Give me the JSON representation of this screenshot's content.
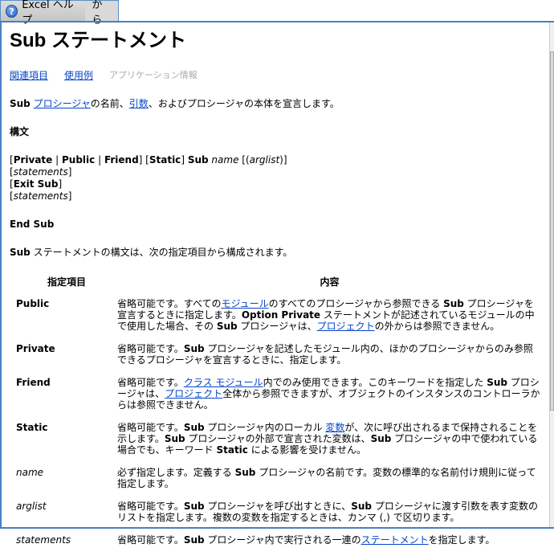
{
  "tabs": {
    "app": "Excel ヘルプ",
    "from": "から"
  },
  "title": "Sub ステートメント",
  "nav": {
    "related": "関連項目",
    "example": "使用例",
    "app_info": "アプリケーション情報"
  },
  "intro": [
    {
      "b": "Sub"
    },
    {
      "t": " "
    },
    {
      "a": "プロシージャ"
    },
    {
      "t": "の名前、"
    },
    {
      "a": "引数"
    },
    {
      "t": "、およびプロシージャの本体を宣言します。"
    }
  ],
  "syntax_heading": "構文",
  "syntax": {
    "line1": [
      {
        "t": "["
      },
      {
        "b": "Private"
      },
      {
        "t": " | "
      },
      {
        "b": "Public"
      },
      {
        "t": " | "
      },
      {
        "b": "Friend"
      },
      {
        "t": "] ["
      },
      {
        "b": "Static"
      },
      {
        "t": "] "
      },
      {
        "b": "Sub"
      },
      {
        "t": " "
      },
      {
        "i": "name"
      },
      {
        "t": " [("
      },
      {
        "i": "arglist"
      },
      {
        "t": ")]"
      }
    ],
    "line2": [
      {
        "t": "["
      },
      {
        "i": "statements"
      },
      {
        "t": "]"
      }
    ],
    "line3": [
      {
        "t": "["
      },
      {
        "b": "Exit Sub"
      },
      {
        "t": "]"
      }
    ],
    "line4": [
      {
        "t": "["
      },
      {
        "i": "statements"
      },
      {
        "t": "]"
      }
    ],
    "end": "End Sub"
  },
  "summary": [
    {
      "b": "Sub"
    },
    {
      "t": " ステートメントの構文は、次の指定項目から構成されます。"
    }
  ],
  "table": {
    "headers": [
      "指定項目",
      "内容"
    ],
    "rows": [
      {
        "key": "Public",
        "italic": false,
        "desc": [
          {
            "t": "省略可能です。すべての"
          },
          {
            "a": "モジュール"
          },
          {
            "t": "のすべてのプロシージャから参照できる "
          },
          {
            "b": "Sub"
          },
          {
            "t": " プロシージャを宣言するときに指定します。"
          },
          {
            "b": "Option Private"
          },
          {
            "t": " ステートメントが記述されているモジュールの中で使用した場合、その "
          },
          {
            "b": "Sub"
          },
          {
            "t": " プロシージャは、"
          },
          {
            "a": "プロジェクト"
          },
          {
            "t": "の外からは参照できません。"
          }
        ]
      },
      {
        "key": "Private",
        "italic": false,
        "desc": [
          {
            "t": "省略可能です。"
          },
          {
            "b": "Sub"
          },
          {
            "t": " プロシージャを記述したモジュール内の、ほかのプロシージャからのみ参照できるプロシージャを宣言するときに、指定します。"
          }
        ]
      },
      {
        "key": "Friend",
        "italic": false,
        "desc": [
          {
            "t": "省略可能です。"
          },
          {
            "a": "クラス モジュール"
          },
          {
            "t": "内でのみ使用できます。このキーワードを指定した "
          },
          {
            "b": "Sub"
          },
          {
            "t": " プロシージャは、"
          },
          {
            "a": "プロジェクト"
          },
          {
            "t": "全体から参照できますが、オブジェクトのインスタンスのコントローラからは参照できません。"
          }
        ]
      },
      {
        "key": "Static",
        "italic": false,
        "desc": [
          {
            "t": "省略可能です。"
          },
          {
            "b": "Sub"
          },
          {
            "t": " プロシージャ内のローカル "
          },
          {
            "a": "変数"
          },
          {
            "t": "が、次に呼び出されるまで保持されることを示します。"
          },
          {
            "b": "Sub"
          },
          {
            "t": " プロシージャの外部で宣言された変数は、"
          },
          {
            "b": "Sub"
          },
          {
            "t": " プロシージャの中で使われている場合でも、キーワード "
          },
          {
            "b": "Static"
          },
          {
            "t": " による影響を受けません。"
          }
        ]
      },
      {
        "key": "name",
        "italic": true,
        "desc": [
          {
            "t": "必ず指定します。定義する "
          },
          {
            "b": "Sub"
          },
          {
            "t": " プロシージャの名前です。変数の標準的な名前付け規則に従って指定します。"
          }
        ]
      },
      {
        "key": "arglist",
        "italic": true,
        "desc": [
          {
            "t": "省略可能です。"
          },
          {
            "b": "Sub"
          },
          {
            "t": " プロシージャを呼び出すときに、"
          },
          {
            "b": "Sub"
          },
          {
            "t": " プロシージャに渡す引数を表す変数のリストを指定します。複数の変数を指定するときは、カンマ (,) で区切ります。"
          }
        ]
      },
      {
        "key": "statements",
        "italic": true,
        "desc": [
          {
            "t": "省略可能です。"
          },
          {
            "b": "Sub"
          },
          {
            "t": " プロシージャ内で実行される一連の"
          },
          {
            "a": "ステートメント"
          },
          {
            "t": "を指定します。"
          }
        ]
      }
    ]
  },
  "colors": {
    "link": "#0645c8",
    "border": "#4a7fc1"
  }
}
